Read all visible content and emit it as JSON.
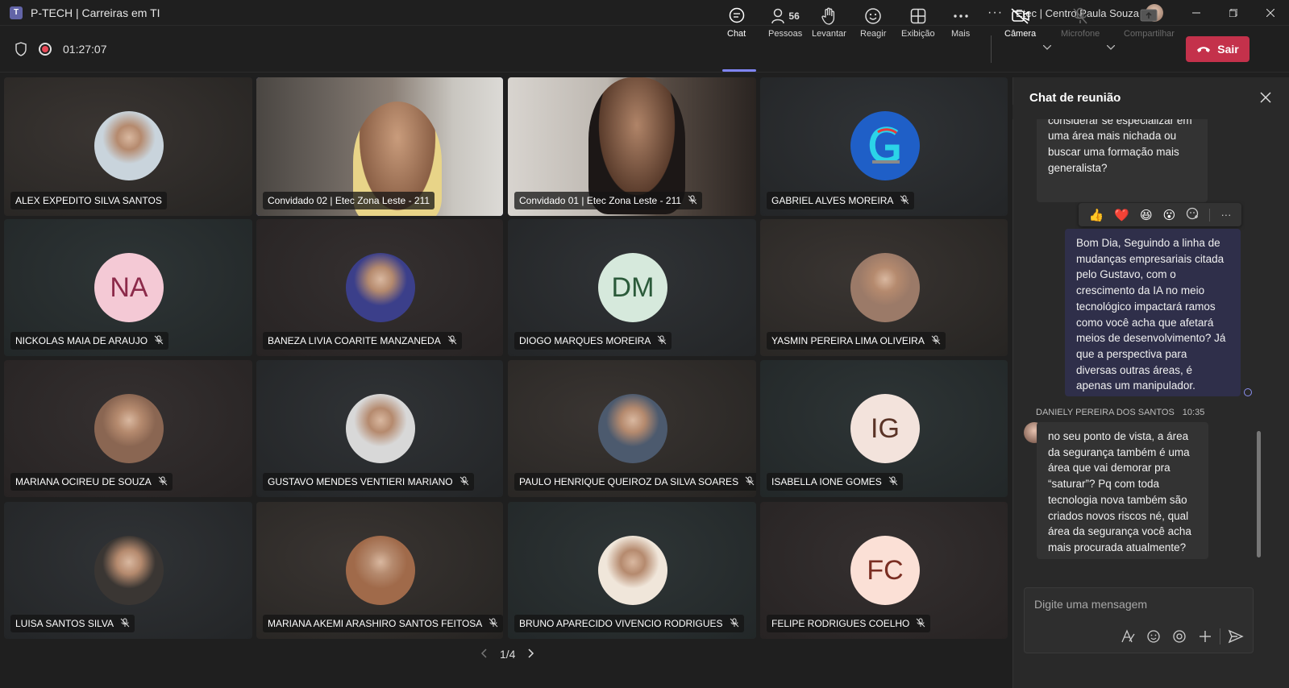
{
  "window": {
    "title": "P-TECH | Carreiras em TI",
    "org": "Etec | Centro Paula Souza",
    "more": "···"
  },
  "meeting": {
    "timer": "01:27:07",
    "people_count": "56"
  },
  "toolbar": {
    "chat": "Chat",
    "people": "Pessoas",
    "raise": "Levantar",
    "react": "Reagir",
    "view": "Exibição",
    "more": "Mais",
    "camera": "Câmera",
    "mic": "Microfone",
    "share": "Compartilhar",
    "leave": "Sair"
  },
  "participants": [
    {
      "name": "ALEX EXPEDITO SILVA SANTOS",
      "type": "photo",
      "muted": false,
      "avatar_color": "#c9d4dc"
    },
    {
      "name": "Convidado 02 | Etec Zona Leste - 211",
      "type": "video",
      "muted": false,
      "speaking": true
    },
    {
      "name": "Convidado 01 | Etec Zona Leste - 211",
      "type": "video",
      "muted": true
    },
    {
      "name": "GABRIEL ALVES MOREIRA",
      "type": "logo",
      "muted": true,
      "avatar_color": "#1f5fc7"
    },
    {
      "name": "NICKOLAS MAIA DE ARAUJO",
      "type": "initials",
      "initials": "NA",
      "muted": true,
      "avatar_color": "#f4c9d5",
      "text_color": "#8c2a4a"
    },
    {
      "name": "BANEZA LIVIA COARITE MANZANEDA",
      "type": "photo",
      "muted": true,
      "avatar_color": "#3b3f8a"
    },
    {
      "name": "DIOGO MARQUES MOREIRA",
      "type": "initials",
      "initials": "DM",
      "muted": true,
      "avatar_color": "#d6e9dc",
      "text_color": "#2b5a3a"
    },
    {
      "name": "YASMIN PEREIRA LIMA OLIVEIRA",
      "type": "photo",
      "muted": true,
      "avatar_color": "#9b7a68"
    },
    {
      "name": "MARIANA OCIREU DE SOUZA",
      "type": "photo",
      "muted": true,
      "avatar_color": "#8a6652"
    },
    {
      "name": "GUSTAVO MENDES VENTIERI MARIANO",
      "type": "photo",
      "muted": true,
      "avatar_color": "#d8d8d8"
    },
    {
      "name": "PAULO HENRIQUE QUEIROZ DA SILVA SOARES",
      "type": "photo",
      "muted": true,
      "avatar_color": "#4c5a6e"
    },
    {
      "name": "ISABELLA IONE GOMES",
      "type": "initials",
      "initials": "IG",
      "muted": true,
      "avatar_color": "#f3e3dc",
      "text_color": "#5a3326"
    },
    {
      "name": "LUISA SANTOS SILVA",
      "type": "photo",
      "muted": true,
      "avatar_color": "#3a3633"
    },
    {
      "name": "MARIANA AKEMI ARASHIRO SANTOS FEITOSA",
      "type": "photo",
      "muted": true,
      "avatar_color": "#a06a4a"
    },
    {
      "name": "BRUNO APARECIDO VIVENCIO RODRIGUES",
      "type": "photo",
      "muted": true,
      "avatar_color": "#f0e6da"
    },
    {
      "name": "FELIPE RODRIGUES COELHO",
      "type": "initials",
      "initials": "FC",
      "muted": true,
      "avatar_color": "#fbe0d6",
      "text_color": "#7a2e22"
    }
  ],
  "pager": {
    "label": "1/4"
  },
  "chat": {
    "title": "Chat de reunião",
    "messages": [
      {
        "kind": "in",
        "text": "profissional de TI deve considerar se especializar em uma área mais nichada ou buscar uma formação mais generalista?"
      },
      {
        "kind": "out",
        "text": "Bom Dia, Seguindo a linha de mudanças empresariais citada pelo Gustavo, com o crescimento da IA no meio tecnológico impactará ramos como você acha que afetará meios de desenvolvimento? Já que a perspectiva para diversas outras áreas, é apenas um manipulador."
      },
      {
        "kind": "in",
        "sender": "DANIELY PEREIRA DOS SANTOS",
        "time": "10:35",
        "text": "no seu ponto de vista, a área da segurança também é uma área que vai demorar pra “saturar”? Pq com toda tecnologia nova também são criados novos riscos né, qual área da segurança você acha mais procurada atualmente?"
      }
    ],
    "reactions": [
      "👍",
      "❤️",
      "😆",
      "😮",
      "more-reactions-icon",
      "···"
    ],
    "compose_placeholder": "Digite uma mensagem"
  }
}
